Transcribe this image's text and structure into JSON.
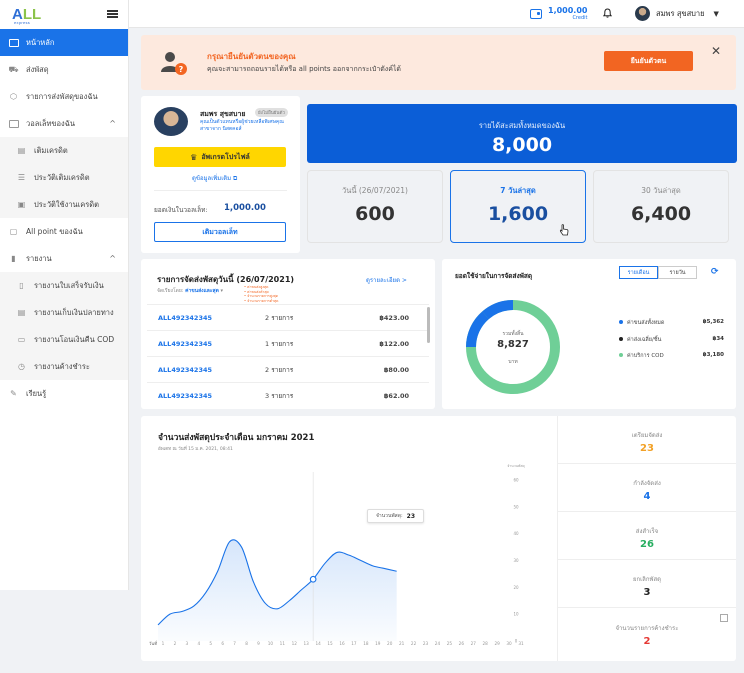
{
  "brand": {
    "logo_main": "A",
    "logo_ll": "LL",
    "logo_sub": "express"
  },
  "sidebar": {
    "items": [
      {
        "label": "หน้าหลัก",
        "icon": "calendar-icon"
      },
      {
        "label": "ส่งพัสดุ",
        "icon": "truck-icon"
      },
      {
        "label": "รายการส่งพัสดุของฉัน",
        "icon": "box-icon"
      },
      {
        "label": "วอลเล็ทของฉัน",
        "icon": "wallet-icon"
      },
      {
        "label": "เติมเครดิต",
        "icon": "topup-icon"
      },
      {
        "label": "ประวัติเติมเครดิต",
        "icon": "history-icon"
      },
      {
        "label": "ประวัติใช้งานเครดิต",
        "icon": "usage-icon"
      },
      {
        "label": "All point ของฉัน",
        "icon": "point-icon"
      },
      {
        "label": "รายงาน",
        "icon": "report-icon"
      },
      {
        "label": "รายงานใบเสร็จรับเงิน",
        "icon": "receipt-icon"
      },
      {
        "label": "รายงานเก็บเงินปลายทาง",
        "icon": "cod-icon"
      },
      {
        "label": "รายงานโอนเงินคืน COD",
        "icon": "refund-icon"
      },
      {
        "label": "รายงานค้างชำระ",
        "icon": "overdue-icon"
      },
      {
        "label": "เรียนรู้",
        "icon": "learn-icon"
      }
    ]
  },
  "topbar": {
    "credit_value": "1,000.00",
    "credit_label": "Credit",
    "user_name": "สมพร สุขสบาย"
  },
  "alert": {
    "title": "กรุณายืนยันตัวตนของคุณ",
    "desc": "คุณจะสามารถถอนรายได้หรือ all points ออกจากกระเป๋าตังค์ได้",
    "button": "ยืนยันตัวตน",
    "close": "✕"
  },
  "profile": {
    "name": "สมพร สุขสบาย",
    "badge": "ยังไม่ยืนยันตัว",
    "desc1": "คุณเป็นตัวแทนหรือผู้ช่วยเหลือพิเศษคุณ",
    "desc2": "สาขาจาก นิสตคอส์",
    "upgrade": "อัพเกรดโปรไฟล์",
    "info": "ดูข้อมูลเพิ่มเติม",
    "balance_label": "ยอดเงินในวอลเล็ท:",
    "balance_value": "1,000.00",
    "topup": "เติมวอลเล็ท"
  },
  "stats": {
    "total_label": "รายได้สะสมทั้งหมดของฉัน",
    "total_value": "8,000",
    "boxes": [
      {
        "label": "วันนี้ (26/07/2021)",
        "value": "600"
      },
      {
        "label": "7 วันล่าสุด",
        "value": "1,600"
      },
      {
        "label": "30 วันล่าสุด",
        "value": "6,400"
      }
    ]
  },
  "shipments": {
    "title": "รายการจัดส่งพัสดุวันนี้ (26/07/2021)",
    "sort_label": "จัดเรียงโดย:",
    "sort_value": "ค่าขนส่งและสุด",
    "tips": [
      "• ค่าขนส่งสูงสุด",
      "• ค่าขนส่งต่ำสุด",
      "• จำนวนรายการสูงสุด",
      "• จำนวนรายการต่ำสุด"
    ],
    "view_all": "ดูรายละเอียด >",
    "rows": [
      {
        "id": "ALL492342345",
        "count": "2 รายการ",
        "amount": "฿423.00"
      },
      {
        "id": "ALL492342345",
        "count": "1 รายการ",
        "amount": "฿122.00"
      },
      {
        "id": "ALL492342345",
        "count": "2 รายการ",
        "amount": "฿80.00"
      },
      {
        "id": "ALL492342345",
        "count": "3 รายการ",
        "amount": "฿62.00"
      }
    ]
  },
  "expense": {
    "title": "ยอดใช้จ่ายในการจัดส่งพัสดุ",
    "tab_month": "รายเดือน",
    "tab_day": "รายวัน",
    "center_label": "รวมทั้งสิ้น",
    "center_value": "8,827",
    "center_unit": "บาท",
    "legend": [
      {
        "label": "ค่าขนส่งทั้งหมด",
        "value": "฿5,362",
        "color": "#1a73e8"
      },
      {
        "label": "ค่าส่งเฉลี่ย/ชิ้น",
        "value": "฿34",
        "color": "#222222"
      },
      {
        "label": "ค่าบริการ COD",
        "value": "฿3,180",
        "color": "#6fcf97"
      }
    ]
  },
  "monthly": {
    "title": "จำนวนส่งพัสดุประจำเดือน มกราคม 2021",
    "subtitle": "อัพเดท ณ วันที่ 15 ม.ค. 2021, 08:41",
    "tooltip_label": "จำนวนพัสดุ:",
    "tooltip_value": "23",
    "summary": [
      {
        "label": "เตรียมจัดส่ง",
        "value": "23",
        "color": "#f2a127"
      },
      {
        "label": "กำลังจัดส่ง",
        "value": "4",
        "color": "#1a73e8"
      },
      {
        "label": "ส่งสำเร็จ",
        "value": "26",
        "color": "#27ae60"
      },
      {
        "label": "ยกเลิกพัสดุ",
        "value": "3",
        "color": "#222222"
      },
      {
        "label": "จำนวนรายการค้างชำระ",
        "value": "2",
        "color": "#e53935"
      }
    ]
  },
  "chart_data": {
    "type": "area",
    "title": "จำนวนส่งพัสดุประจำเดือน มกราคม 2021",
    "xlabel": "วันที่",
    "ylabel": "จำนวนพัสดุ",
    "x": [
      1,
      2,
      3,
      4,
      5,
      6,
      7,
      8,
      9,
      10,
      11,
      12,
      13,
      14,
      15,
      16,
      17,
      18,
      19,
      20,
      21
    ],
    "values": [
      6,
      10,
      11,
      13,
      18,
      26,
      37,
      35,
      22,
      14,
      12,
      15,
      19,
      23,
      29,
      33,
      32,
      30,
      28,
      27,
      26
    ],
    "ylim": [
      0,
      60
    ],
    "yticks": [
      0,
      10,
      20,
      30,
      40,
      50,
      60
    ],
    "xticks": [
      1,
      2,
      3,
      4,
      5,
      6,
      7,
      8,
      9,
      10,
      11,
      12,
      13,
      14,
      15,
      16,
      17,
      18,
      19,
      20,
      21,
      22,
      23,
      24,
      25,
      26,
      27,
      28,
      29,
      30,
      31
    ],
    "highlight_x": 14,
    "color": "#1a73e8",
    "grid": false
  }
}
